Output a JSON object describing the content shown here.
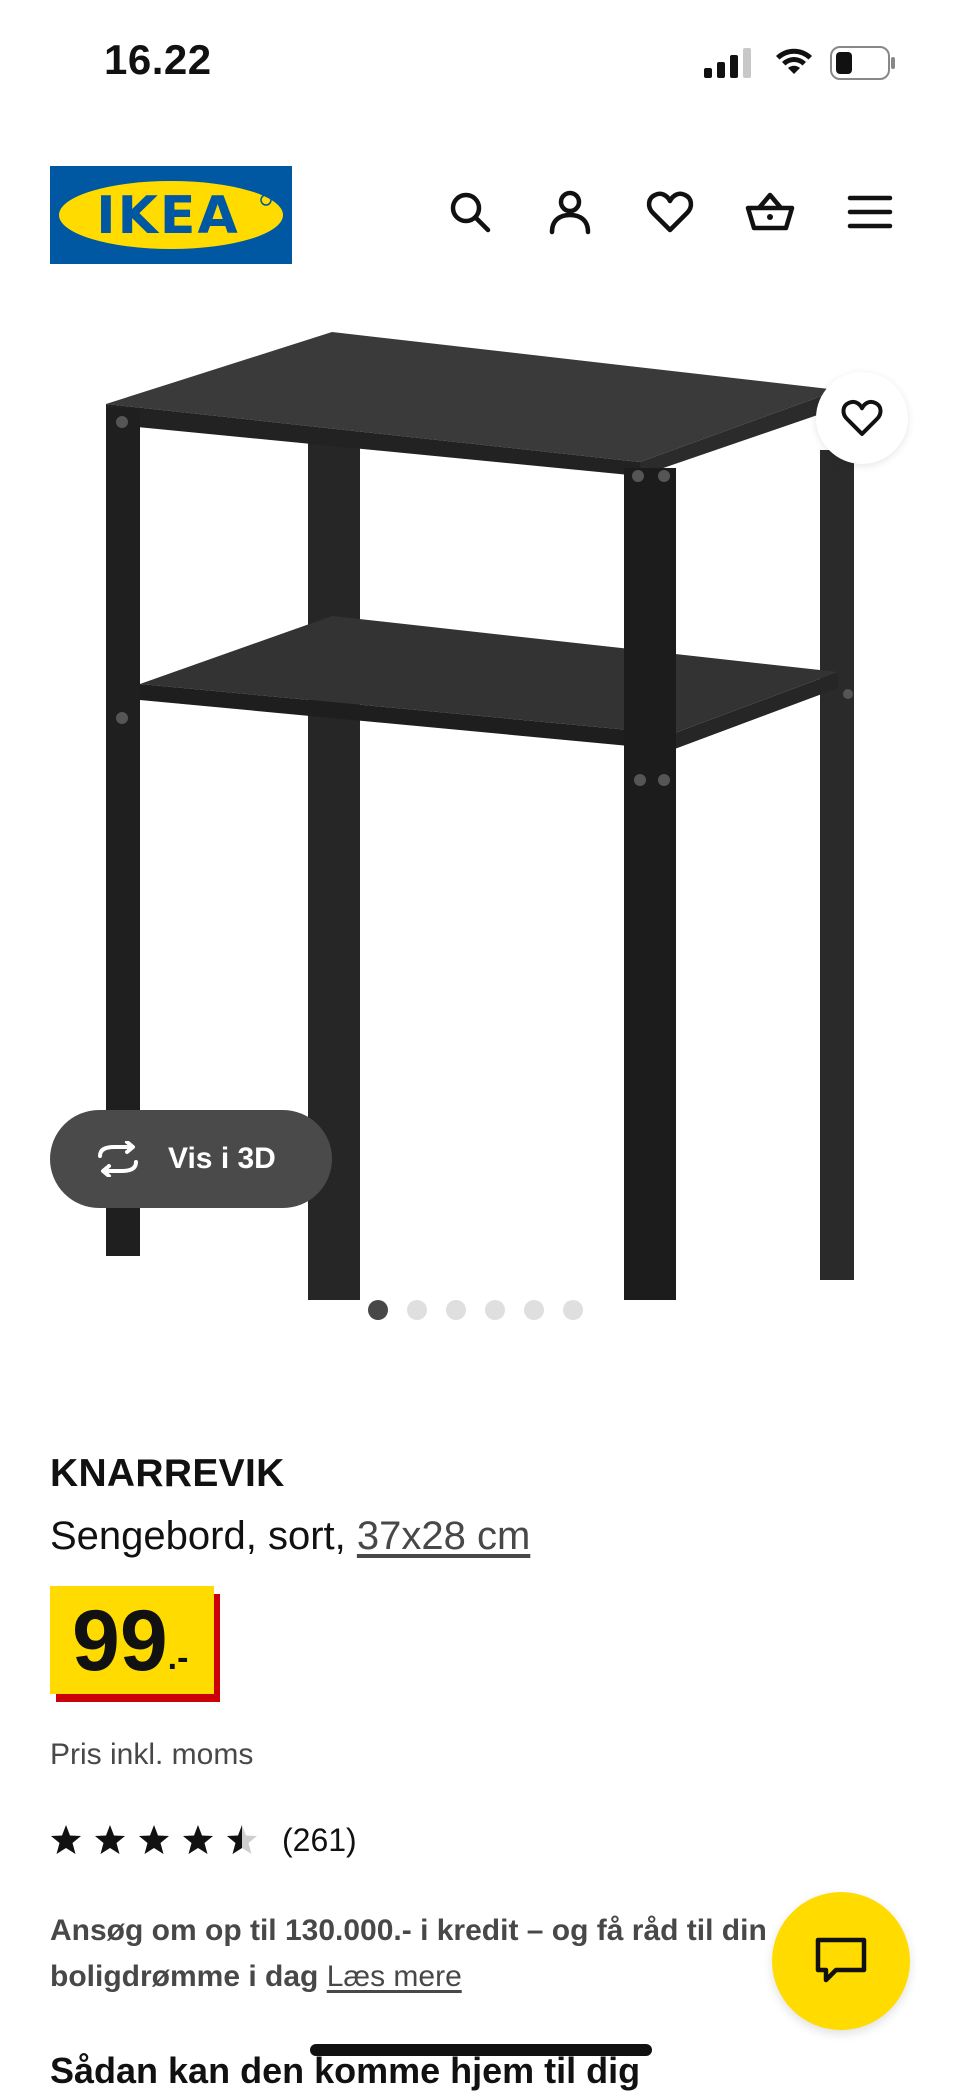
{
  "status_bar": {
    "time": "16.22"
  },
  "header": {
    "logo_text": "IKEA",
    "icons": [
      "search-icon",
      "profile-icon",
      "favourites-icon",
      "basket-icon",
      "menu-icon"
    ]
  },
  "gallery": {
    "view_3d_label": "Vis i 3D",
    "image_count": 6,
    "active_index": 0
  },
  "product": {
    "name": "KNARREVIK",
    "description": "Sengebord, sort,",
    "size_link": "37x28 cm",
    "price": {
      "integer": "99",
      "suffix": ".-"
    },
    "price_note": "Pris inkl. moms",
    "rating": {
      "stars": 4.5,
      "count": "(261)"
    }
  },
  "credit": {
    "text": "Ansøg om op til 130.000.- i kredit – og få råd til din boligdrømme i dag",
    "link": "Læs mere"
  },
  "next_section_title": "Sådan kan den komme hjem til dig",
  "colors": {
    "ikea_blue": "#0058a3",
    "ikea_yellow": "#ffdb00",
    "price_red": "#cc0008"
  }
}
